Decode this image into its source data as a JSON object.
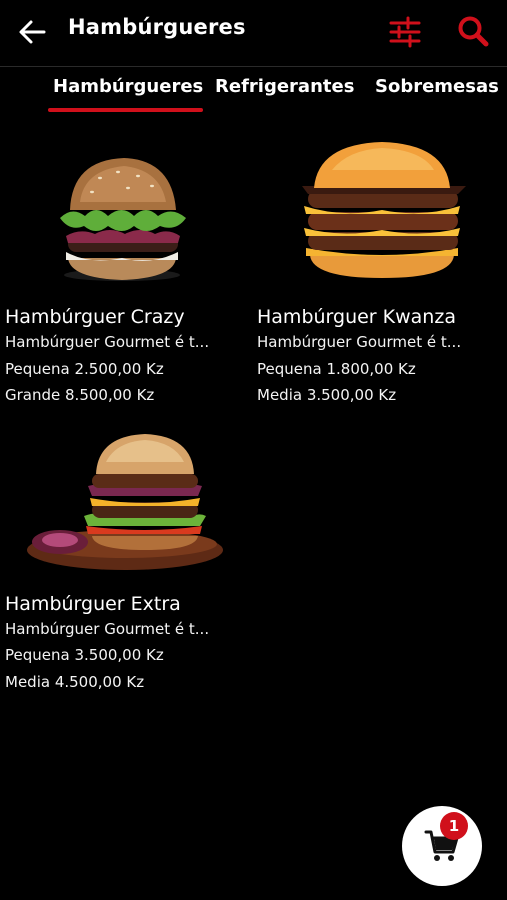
{
  "header": {
    "title": "Hambúrgueres",
    "back_icon": "arrow-left-icon",
    "filter_icon": "sliders-icon",
    "search_icon": "search-icon"
  },
  "tabs": [
    {
      "label": "Hambúrgueres",
      "active": true
    },
    {
      "label": "Refrigerantes",
      "active": false
    },
    {
      "label": "Sobremesas",
      "active": false
    }
  ],
  "products": [
    {
      "name": "Hambúrguer Crazy",
      "description": "Hambúrguer Gourmet é t...",
      "price_1": "Pequena 2.500,00 Kz",
      "price_2": "Grande 8.500,00 Kz"
    },
    {
      "name": "Hambúrguer Kwanza",
      "description": "Hambúrguer Gourmet é t...",
      "price_1": "Pequena 1.800,00 Kz",
      "price_2": "Media 3.500,00 Kz"
    },
    {
      "name": "Hambúrguer Extra",
      "description": "Hambúrguer Gourmet é t...",
      "price_1": "Pequena 3.500,00 Kz",
      "price_2": "Media 4.500,00 Kz"
    }
  ],
  "cart": {
    "icon": "cart-icon",
    "count": "1"
  },
  "colors": {
    "accent": "#d0101b",
    "background": "#000000",
    "text": "#ffffff"
  }
}
